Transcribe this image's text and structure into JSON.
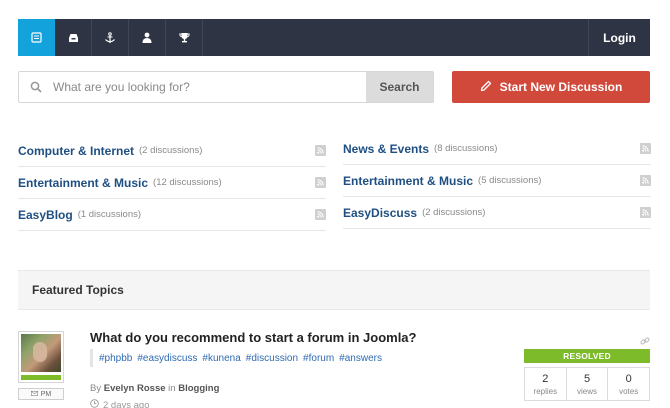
{
  "toolbar": {
    "icons": [
      "discussions-icon",
      "inbox-icon",
      "anchor-icon",
      "user-icon",
      "trophy-icon"
    ],
    "login_label": "Login",
    "active_color": "#14a2dc",
    "bar_color": "#2e3444"
  },
  "search": {
    "placeholder": "What are you looking for?",
    "value": "",
    "button_label": "Search"
  },
  "new_discussion": {
    "label": "Start New Discussion",
    "color": "#d1493b"
  },
  "categories": {
    "left": [
      {
        "name": "Computer & Internet",
        "count": "(2 discussions)"
      },
      {
        "name": "Entertainment & Music",
        "count": "(12 discussions)"
      },
      {
        "name": "EasyBlog",
        "count": "(1 discussions)"
      }
    ],
    "right": [
      {
        "name": "News & Events",
        "count": "(8 discussions)"
      },
      {
        "name": "Entertainment & Music",
        "count": "(5 discussions)"
      },
      {
        "name": "EasyDiscuss",
        "count": "(2 discussions)"
      }
    ]
  },
  "featured": {
    "heading": "Featured Topics"
  },
  "post": {
    "title": "What do you recommend to start a forum in Joomla?",
    "tags": [
      "#phpbb",
      "#easydiscuss",
      "#kunena",
      "#discussion",
      "#forum",
      "#answers"
    ],
    "by": "By",
    "author": "Evelyn Rosse",
    "in": "in",
    "category": "Blogging",
    "time": "2 days ago",
    "pm_label": "PM",
    "status": "RESOLVED",
    "status_color": "#7dbb2a",
    "stats": [
      {
        "num": "2",
        "label": "replies"
      },
      {
        "num": "5",
        "label": "views"
      },
      {
        "num": "0",
        "label": "votes"
      }
    ]
  }
}
